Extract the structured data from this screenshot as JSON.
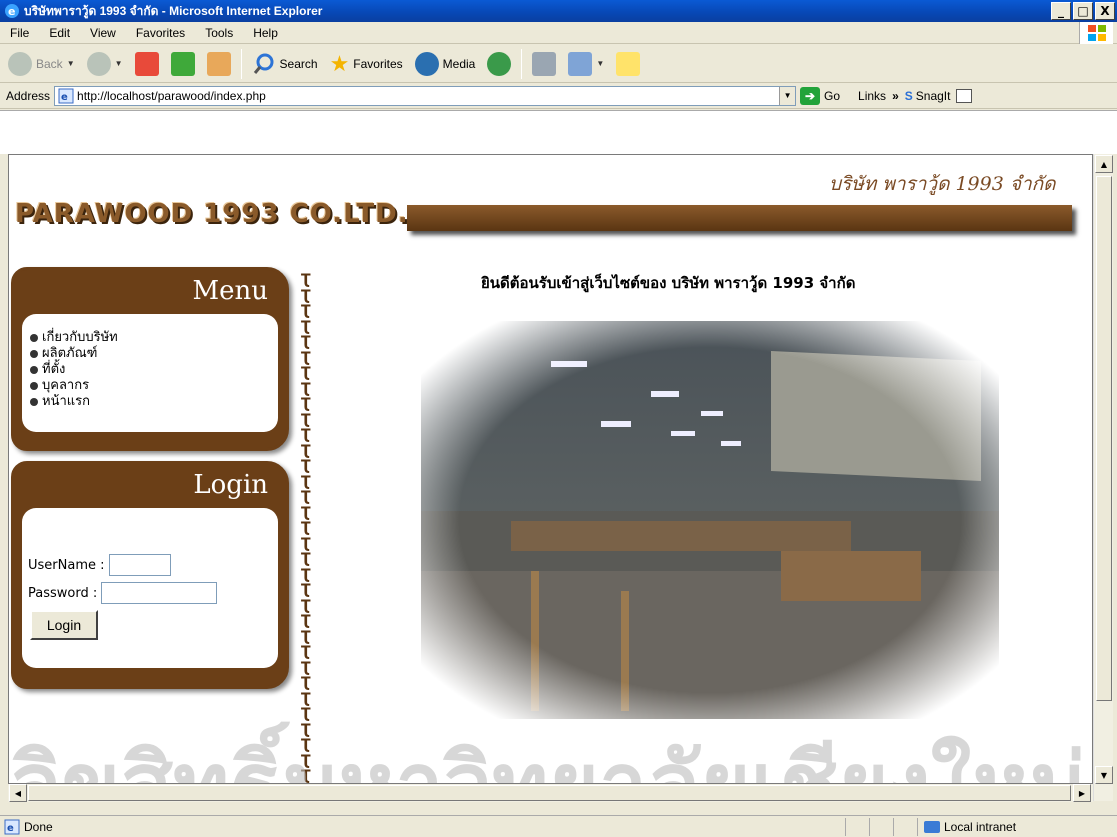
{
  "window": {
    "title": "บริษัทพาราวู้ด 1993 จำกัด - Microsoft Internet Explorer",
    "controls": [
      "_",
      "□",
      "X"
    ]
  },
  "menubar": {
    "items": [
      "File",
      "Edit",
      "View",
      "Favorites",
      "Tools",
      "Help"
    ]
  },
  "toolbar": {
    "back": "Back",
    "search": "Search",
    "favorites": "Favorites",
    "media": "Media"
  },
  "address": {
    "label": "Address",
    "url": "http://localhost/parawood/index.php",
    "go": "Go",
    "links": "Links",
    "links_more": "»",
    "snagit": "SnagIt"
  },
  "page": {
    "tagline": "บริษัท พาราวู้ด 1993 จำกัด",
    "brand": "PARAWOOD 1993 CO.LTD.",
    "welcome": "ยินดีต้อนรับเข้าสู่เว็บไซต์ของ บริษัท พาราวู้ด 1993 จำกัด",
    "menu": {
      "title": "Menu",
      "items": [
        "เกี่ยวกับบริษัท",
        "ผลิตภัณฑ์",
        "ที่ตั้ง",
        "บุคลากร",
        "หน้าแรก"
      ]
    },
    "login": {
      "title": "Login",
      "username_label": "UserName :",
      "password_label": "Password :",
      "username_value": "",
      "password_value": "",
      "button": "Login"
    },
    "watermark": "ลิขสิทธิ์มหาวิทยาลัยเชียงใหม่"
  },
  "status": {
    "text": "Done",
    "zone": "Local intranet"
  },
  "colors": {
    "brown": "#6b3f17",
    "title_blue": "#0a5ad4"
  }
}
